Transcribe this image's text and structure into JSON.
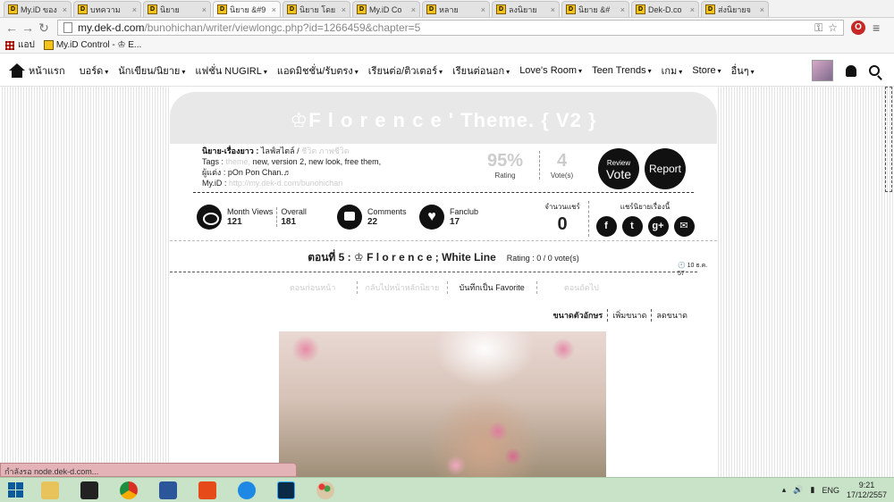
{
  "browser": {
    "tabs": [
      {
        "title": "My.iD ของ",
        "active": false
      },
      {
        "title": "บทความ",
        "active": false
      },
      {
        "title": "นิยาย",
        "active": false
      },
      {
        "title": "นิยาย &#9",
        "active": true
      },
      {
        "title": "นิยาย โดย",
        "active": false
      },
      {
        "title": "My.iD Co",
        "active": false
      },
      {
        "title": "หลาย",
        "active": false
      },
      {
        "title": "ลงนิยาย",
        "active": false
      },
      {
        "title": "นิยาย &#",
        "active": false
      },
      {
        "title": "Dek-D.co",
        "active": false
      },
      {
        "title": "ส่งนิยายจ",
        "active": false
      }
    ],
    "url_host": "my.dek-d.com",
    "url_path": "/bunohichan/writer/viewlongc.php?id=1266459&chapter=5",
    "bookmarks": {
      "apps_label": "แอป",
      "item": "My.iD Control - ♔ E..."
    },
    "status_text": "กำลังรอ node.dek-d.com..."
  },
  "sitenav": {
    "home": "หน้าแรก",
    "items": [
      "บอร์ด",
      "นักเขียน/นิยาย",
      "แฟชั่น NUGIRL",
      "แอดมิชชั่น/รับตรง",
      "เรียนต่อ/ติวเตอร์",
      "เรียนต่อนอก",
      "Love's Room",
      "Teen Trends",
      "เกม",
      "Store",
      "อื่นๆ"
    ]
  },
  "header": {
    "title": "♔F l o r e n c e ' Theme. { V2 }"
  },
  "info": {
    "type_label": "นิยาย-เรื่องยาว :",
    "type_value": "ไลฟ์สไตล์ /",
    "type_value_muted": "ชีวิต ภาพชีวิต",
    "tags_label": "Tags :",
    "tags_muted": "theme,",
    "tags": "new, version 2, new look, free them,",
    "author_label": "ผู้แต่ง :",
    "author": "pOn Pon Chan.♬",
    "myid_label": "My.iD :",
    "myid": "http://my.dek-d.com/bunohichan"
  },
  "rating": {
    "percent": "95%",
    "percent_label": "Rating",
    "votes": "4",
    "votes_label": "Vote(s)"
  },
  "buttons": {
    "review_top": "Review",
    "review_bottom": "Vote",
    "report": "Report"
  },
  "stats": {
    "month_views_label": "Month Views",
    "month_views": "121",
    "overall_label": "Overall",
    "overall": "181",
    "comments_label": "Comments",
    "comments": "22",
    "fanclub_label": "Fanclub",
    "fanclub": "17"
  },
  "share": {
    "count_label": "จำนวนแชร์",
    "count": "0",
    "title": "แชร์นิยายเรื่องนี้",
    "icons": [
      "f",
      "t",
      "g+",
      "✉"
    ]
  },
  "chapter": {
    "title": "ตอนที่ 5 : ♔ F l o r e n c e ; White Line",
    "rating_inline": "Rating : 0 / 0 vote(s)",
    "date": "🕙 10 ธ.ค. 57"
  },
  "chapnav": {
    "prev": "ตอนก่อนหน้า",
    "back": "กลับไปหน้าหลักนิยาย",
    "favorite": "บันทึกเป็น Favorite",
    "next": "ตอนถัดไป"
  },
  "fontsize": {
    "label": "ขนาดตัวอักษร",
    "increase": "เพิ่มขนาด",
    "decrease": "ลดขนาด"
  },
  "taskbar": {
    "lang": "ENG",
    "time": "9:21",
    "date": "17/12/2557"
  },
  "colors": {
    "header_band": "#e8e8e8",
    "taskbar": "#c9e3c8",
    "status": "#e4b3b8"
  }
}
